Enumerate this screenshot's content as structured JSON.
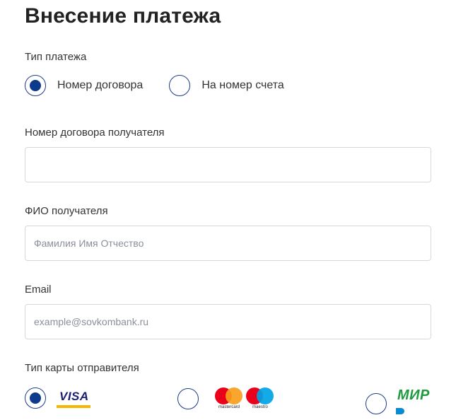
{
  "page": {
    "title": "Внесение платежа"
  },
  "payment_type": {
    "label": "Тип платежа",
    "options": [
      {
        "label": "Номер договора",
        "selected": true
      },
      {
        "label": "На номер счета",
        "selected": false
      }
    ]
  },
  "contract_number": {
    "label": "Номер договора получателя",
    "value": "",
    "placeholder": ""
  },
  "recipient_name": {
    "label": "ФИО получателя",
    "value": "",
    "placeholder": "Фамилия Имя Отчество"
  },
  "email": {
    "label": "Email",
    "value": "",
    "placeholder": "example@sovkombank.ru"
  },
  "sender_card_type": {
    "label": "Тип карты отправителя",
    "options": [
      {
        "name": "visa",
        "logo_text": "VISA",
        "selected": true
      },
      {
        "name": "mastercard-maestro",
        "captions": [
          "mastercard",
          "maestro"
        ],
        "selected": false
      },
      {
        "name": "mir",
        "logo_text": "МИР",
        "selected": false
      }
    ]
  },
  "colors": {
    "accent": "#0e3a8c",
    "visa_blue": "#1a1f71",
    "visa_gold": "#f7b600",
    "mc_red": "#eb001b",
    "mc_orange": "#f79e1b",
    "maestro_blue": "#00a2e5",
    "mir_green": "#1f9b3f",
    "mir_blue": "#0a8bd0"
  }
}
